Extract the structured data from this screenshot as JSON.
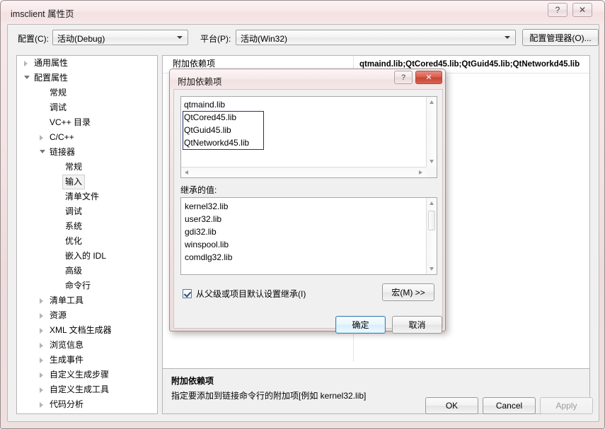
{
  "window": {
    "title": "imsclient 属性页",
    "help_glyph": "?",
    "close_glyph": "✕"
  },
  "config_bar": {
    "config_label": "配置(C):",
    "config_value": "活动(Debug)",
    "platform_label": "平台(P):",
    "platform_value": "活动(Win32)",
    "config_manager_button": "配置管理器(O)..."
  },
  "tree": {
    "items": [
      {
        "label": "通用属性",
        "indent": 0,
        "twisty": "collapsed",
        "selected": false
      },
      {
        "label": "配置属性",
        "indent": 0,
        "twisty": "expanded",
        "selected": false
      },
      {
        "label": "常规",
        "indent": 1,
        "twisty": "none",
        "selected": false
      },
      {
        "label": "调试",
        "indent": 1,
        "twisty": "none",
        "selected": false
      },
      {
        "label": "VC++ 目录",
        "indent": 1,
        "twisty": "none",
        "selected": false
      },
      {
        "label": "C/C++",
        "indent": 1,
        "twisty": "collapsed",
        "selected": false
      },
      {
        "label": "链接器",
        "indent": 1,
        "twisty": "expanded",
        "selected": false
      },
      {
        "label": "常规",
        "indent": 2,
        "twisty": "none",
        "selected": false
      },
      {
        "label": "输入",
        "indent": 2,
        "twisty": "none",
        "selected": true
      },
      {
        "label": "清单文件",
        "indent": 2,
        "twisty": "none",
        "selected": false
      },
      {
        "label": "调试",
        "indent": 2,
        "twisty": "none",
        "selected": false
      },
      {
        "label": "系统",
        "indent": 2,
        "twisty": "none",
        "selected": false
      },
      {
        "label": "优化",
        "indent": 2,
        "twisty": "none",
        "selected": false
      },
      {
        "label": "嵌入的 IDL",
        "indent": 2,
        "twisty": "none",
        "selected": false
      },
      {
        "label": "高级",
        "indent": 2,
        "twisty": "none",
        "selected": false
      },
      {
        "label": "命令行",
        "indent": 2,
        "twisty": "none",
        "selected": false
      },
      {
        "label": "清单工具",
        "indent": 1,
        "twisty": "collapsed",
        "selected": false
      },
      {
        "label": "资源",
        "indent": 1,
        "twisty": "collapsed",
        "selected": false
      },
      {
        "label": "XML 文档生成器",
        "indent": 1,
        "twisty": "collapsed",
        "selected": false
      },
      {
        "label": "浏览信息",
        "indent": 1,
        "twisty": "collapsed",
        "selected": false
      },
      {
        "label": "生成事件",
        "indent": 1,
        "twisty": "collapsed",
        "selected": false
      },
      {
        "label": "自定义生成步骤",
        "indent": 1,
        "twisty": "collapsed",
        "selected": false
      },
      {
        "label": "自定义生成工具",
        "indent": 1,
        "twisty": "collapsed",
        "selected": false
      },
      {
        "label": "代码分析",
        "indent": 1,
        "twisty": "collapsed",
        "selected": false
      }
    ]
  },
  "property_grid": {
    "rows": [
      {
        "name": "附加依赖项",
        "value": "qtmaind.lib;QtCored45.lib;QtGuid45.lib;QtNetworkd45.lib"
      }
    ],
    "description": {
      "title": "附加依赖项",
      "body": "指定要添加到链接命令行的附加项[例如 kernel32.lib]"
    }
  },
  "bottom_buttons": {
    "ok": "OK",
    "cancel": "Cancel",
    "apply": "Apply"
  },
  "modal": {
    "title": "附加依赖项",
    "help_glyph": "?",
    "close_glyph": "✕",
    "edit_lines": [
      "qtmaind.lib",
      "QtCored45.lib",
      "QtGuid45.lib",
      "QtNetworkd45.lib"
    ],
    "inherited_label": "继承的值:",
    "inherited_values": [
      "kernel32.lib",
      "user32.lib",
      "gdi32.lib",
      "winspool.lib",
      "comdlg32.lib"
    ],
    "inherit_checkbox_label": "从父级或项目默认设置继承(I)",
    "inherit_checkbox_checked": true,
    "macro_button": "宏(M) >>",
    "ok_button": "确定",
    "cancel_button": "取消"
  }
}
